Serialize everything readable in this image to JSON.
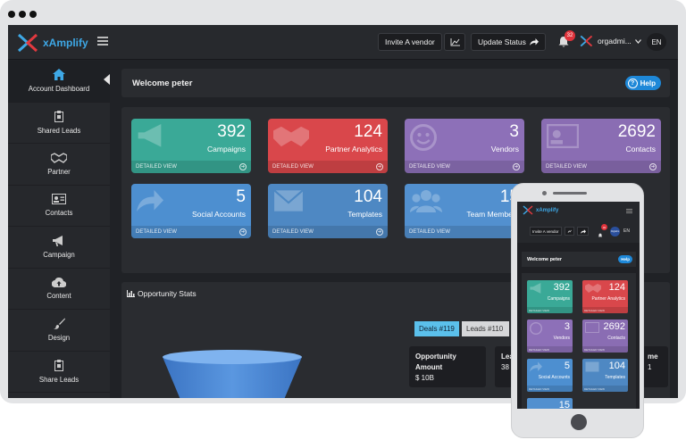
{
  "browser": {
    "dots": [
      "",
      "",
      ""
    ]
  },
  "app": {
    "brand": "xAmplify",
    "topbar": {
      "invite_label": "Invite A vendor",
      "update_status_label": "Update Status",
      "notification_count": "32",
      "user_name": "orgadmi...",
      "language": "EN"
    },
    "sidebar": {
      "items": [
        {
          "label": "Account Dashboard",
          "icon": "home-icon"
        },
        {
          "label": "Shared Leads",
          "icon": "clipboard-icon"
        },
        {
          "label": "Partner",
          "icon": "handshake-icon"
        },
        {
          "label": "Contacts",
          "icon": "contact-card-icon"
        },
        {
          "label": "Campaign",
          "icon": "megaphone-icon"
        },
        {
          "label": "Content",
          "icon": "cloud-upload-icon"
        },
        {
          "label": "Design",
          "icon": "brush-icon"
        },
        {
          "label": "Share Leads",
          "icon": "clipboard-icon"
        }
      ]
    },
    "welcome": {
      "text": "Welcome peter",
      "help_label": "Help"
    },
    "cards": [
      {
        "count": "392",
        "label": "Campaigns",
        "footer": "DETAILED VIEW",
        "color": "#3aa997",
        "icon": "megaphone-icon"
      },
      {
        "count": "124",
        "label": "Partner Analytics",
        "footer": "DETAILED VIEW",
        "color": "#d9474b",
        "icon": "handshake-icon"
      },
      {
        "count": "3",
        "label": "Vendors",
        "footer": "DETAILED VIEW",
        "color": "#8d70b8",
        "icon": "smiley-icon"
      },
      {
        "count": "2692",
        "label": "Contacts",
        "footer": "DETAILED VIEW",
        "color": "#8a6db3",
        "icon": "contact-card-icon"
      },
      {
        "count": "5",
        "label": "Social Accounts",
        "footer": "DETAILED VIEW",
        "color": "#4d8fd0",
        "icon": "share-icon"
      },
      {
        "count": "104",
        "label": "Templates",
        "footer": "DETAILED VIEW",
        "color": "#4e88c3",
        "icon": "envelope-icon"
      },
      {
        "count": "15",
        "label": "Team Members",
        "footer": "DETAILED VIEW",
        "color": "#5290cf",
        "icon": "team-icon"
      }
    ],
    "opportunity": {
      "title": "Opportunity Stats",
      "tabs": [
        "Deals #119",
        "Leads #110"
      ],
      "stats": [
        {
          "label": "Opportunity Amount",
          "value": "$ 10B"
        },
        {
          "label": "Lea",
          "value": "38"
        },
        {
          "label": "me",
          "value": "1"
        }
      ]
    }
  },
  "phone": {
    "brand": "xAmplify",
    "invite_label": "Invite A vendor",
    "notification_count": "32",
    "user_name": "OrgAdm",
    "language": "EN",
    "welcome": "Welcome peter",
    "help_label": "Help",
    "cards": [
      {
        "count": "392",
        "label": "Campaigns",
        "footer": "DETAILED VIEW",
        "color": "#3aa997"
      },
      {
        "count": "124",
        "label": "Partner Analytics",
        "footer": "DETAILED VIEW",
        "color": "#d9474b"
      },
      {
        "count": "3",
        "label": "Vendors",
        "footer": "DETAILED VIEW",
        "color": "#8d70b8"
      },
      {
        "count": "2692",
        "label": "Contacts",
        "footer": "DETAILED VIEW",
        "color": "#8a6db3"
      },
      {
        "count": "5",
        "label": "Social Accounts",
        "footer": "DETAILED VIEW",
        "color": "#4d8fd0"
      },
      {
        "count": "104",
        "label": "Templates",
        "footer": "DETAILED VIEW",
        "color": "#4e88c3"
      },
      {
        "count": "15",
        "label": "",
        "footer": "",
        "color": "#5290cf"
      }
    ]
  }
}
